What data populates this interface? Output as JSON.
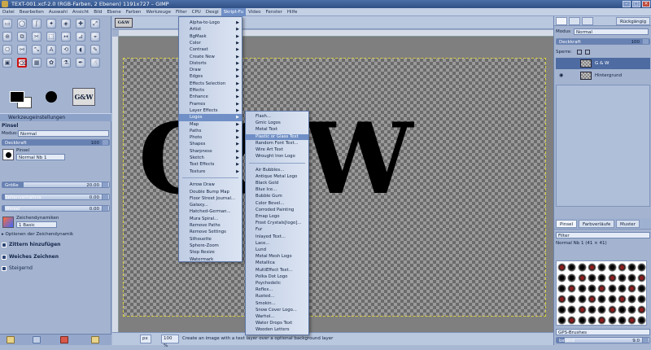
{
  "window": {
    "title": "TEXT-001.xcf-2.0 (RGB-Farben, 2 Ebenen) 1191x727 – GIMP"
  },
  "menubar": {
    "items": [
      "Datei",
      "Bearbeiten",
      "Auswahl",
      "Ansicht",
      "Bild",
      "Ebene",
      "Farben",
      "Werkzeuge",
      "Filter",
      "CPU",
      "Dexgi",
      "Skript-Fu",
      "Video",
      "Fenster",
      "Hilfe"
    ],
    "active_index": 11
  },
  "toolbox": {
    "tool_options_title": "Werkzeugeinstellungen",
    "tool_name": "Pinsel",
    "mode_label": "Modus:",
    "mode_value": "Normal",
    "opacity_label": "Deckkraft",
    "opacity_value": "100",
    "opacity_level": 1.0,
    "brush_label": "Pinsel",
    "brush_value": "Normal Nb 1",
    "size_label": "Größe",
    "size_value": "20.00",
    "size_level": 0.2,
    "aspect_label": "Seitenverhältnis",
    "aspect_value": "0.00",
    "angle_label": "Winkel",
    "angle_value": "0.00",
    "dynamics_label": "Zeichendynamiken",
    "dynamics_value": "1 Basic",
    "dynamics_options": "Optionen der Zeichendynamik",
    "jitter_label": "Zittern hinzufügen",
    "smooth_label": "Weiches Zeichnen",
    "incremental_label": "Steigernd"
  },
  "canvas": {
    "tab_thumb_text": "G&W",
    "image_text": "G&W",
    "status_unit": "px",
    "status_zoom": "100 %",
    "status_message": "Create an image with a text layer over a optional background layer"
  },
  "script_fu_menu": {
    "items": [
      "Alpha-to-Logo",
      "Artist",
      "BgMask",
      "Color",
      "Contrast",
      "Create New",
      "Distorts",
      "Draw",
      "Edges",
      "Effects Selection",
      "Effects",
      "Enhance",
      "Frames",
      "Layer Effects",
      "Logos",
      "Map",
      "Paths",
      "Photo",
      "Shapes",
      "Sharpness",
      "Sketch",
      "Text Effects",
      "Texture",
      "",
      "Arrow Draw",
      "Double Bump Map",
      "Floor Street Journal...",
      "Galaxy...",
      "Hatched-German...",
      "Mura Spiral...",
      "Remove Paths",
      "Remove Settings",
      "Silhouette",
      "Sphere-Zoom",
      "Step Resize",
      "Watermark"
    ],
    "submenu_count": 23,
    "highlight_index": 14
  },
  "logos_menu": {
    "items": [
      "Flash...",
      "Gmic Logos",
      "Metal Text",
      "Plastic or Glass Text",
      "Random Font Text...",
      "Wire Art Text",
      "Wrought Iron Logo",
      "",
      "Air Bubbles...",
      "Antique Metal Logo",
      "Black Gold",
      "Blue Ice...",
      "Bubble Gum",
      "Color Bevel...",
      "Corroded Painting",
      "Emap Logo",
      "Frost Crystals[logo]...",
      "Fur",
      "Inlayed Text...",
      "Lace...",
      "Lund",
      "Metal Mesh Logo",
      "Metallica",
      "MultiEffect Text...",
      "Polka Dot Logo",
      "Psychedelic",
      "Reflex...",
      "Rusted...",
      "Smokin...",
      "Snow Cover Logo...",
      "Warhol...",
      "Water Drops Text",
      "Wooden Letters"
    ],
    "highlight_index": 3
  },
  "layers_dock": {
    "undo_button": "Rückgängig",
    "mode_label": "Modus",
    "mode_value": "Normal",
    "opacity_label": "Deckkraft",
    "opacity_value": "100",
    "lock_label": "Sperre:",
    "layers": [
      {
        "name": "G & W",
        "selected": true
      },
      {
        "name": "Hintergrund",
        "selected": false
      }
    ]
  },
  "brushes_dock": {
    "tabs": [
      "Pinsel",
      "Farbverläufe",
      "Muster"
    ],
    "filter_label": "Filter",
    "brush_info": "Normal Nb 1 (41 × 41)",
    "tag_label": "GPS-Brushes",
    "spacing_label": "bstand",
    "spacing_value": "9.0"
  }
}
